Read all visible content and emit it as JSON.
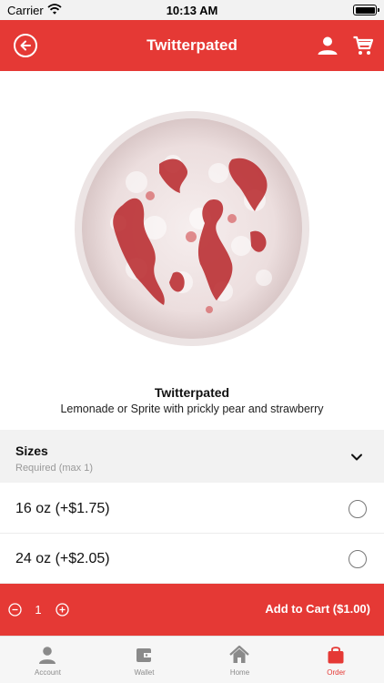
{
  "status_bar": {
    "carrier": "Carrier",
    "time": "10:13 AM"
  },
  "header": {
    "title": "Twitterpated",
    "icons": [
      "back-icon",
      "user-icon",
      "cart-icon"
    ]
  },
  "product": {
    "name": "Twitterpated",
    "description": "Lemonade or Sprite with prickly pear and strawberry"
  },
  "sizes": {
    "label": "Sizes",
    "requirement": "Required (max 1)",
    "options": [
      {
        "label": "16 oz (+$1.75)",
        "selected": false
      },
      {
        "label": "24 oz (+$2.05)",
        "selected": false
      }
    ]
  },
  "cart": {
    "quantity": "1",
    "add_label": "Add to Cart ($1.00)"
  },
  "tabs": [
    {
      "label": "Account",
      "icon": "person-icon",
      "active": false
    },
    {
      "label": "Wallet",
      "icon": "wallet-icon",
      "active": false
    },
    {
      "label": "Home",
      "icon": "home-icon",
      "active": false
    },
    {
      "label": "Order",
      "icon": "bag-icon",
      "active": true
    }
  ],
  "colors": {
    "accent": "#e53935",
    "tab_inactive": "#8a8a8a",
    "section_bg": "#f2f2f2"
  }
}
